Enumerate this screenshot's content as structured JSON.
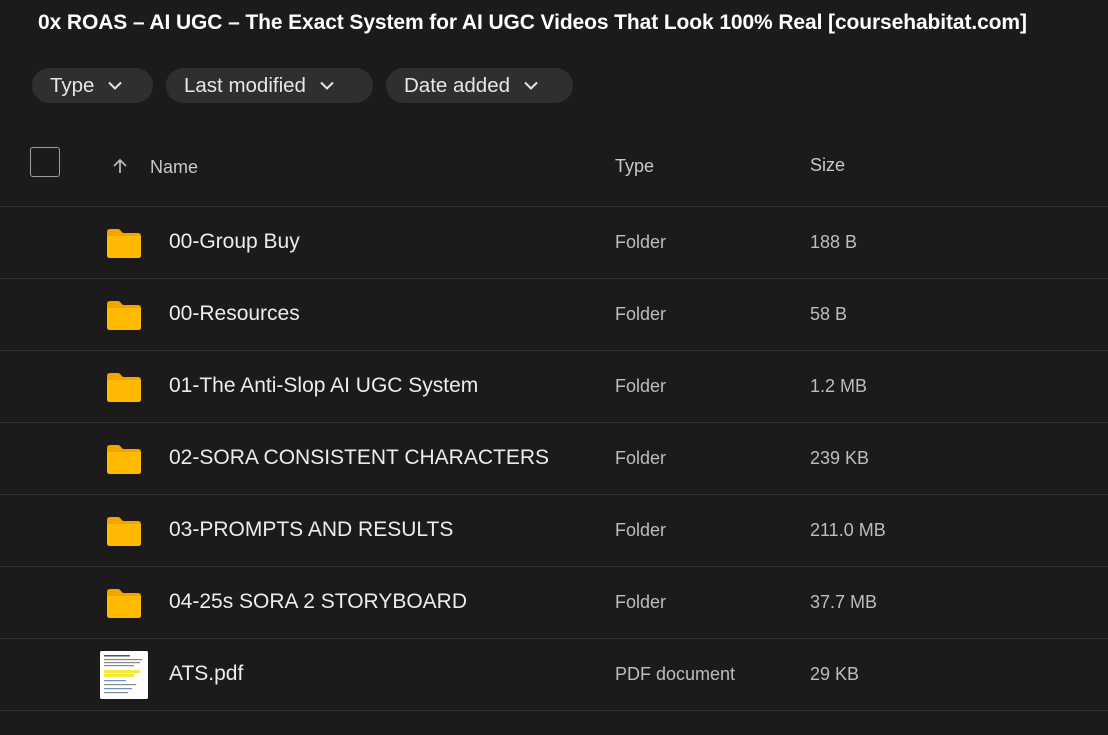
{
  "page": {
    "title": "0x ROAS – AI UGC – The Exact System for AI UGC Videos That Look 100% Real [coursehabitat.com]"
  },
  "filters": [
    {
      "label": "Type"
    },
    {
      "label": "Last modified"
    },
    {
      "label": "Date added"
    }
  ],
  "columns": {
    "name": "Name",
    "type": "Type",
    "size": "Size",
    "sort_direction": "ascending"
  },
  "files": [
    {
      "name": "00-Group Buy",
      "type": "Folder",
      "size": "188 B",
      "icon": "folder-icon"
    },
    {
      "name": "00-Resources",
      "type": "Folder",
      "size": "58 B",
      "icon": "folder-icon"
    },
    {
      "name": "01-The Anti-Slop AI UGC System",
      "type": "Folder",
      "size": "1.2 MB",
      "icon": "folder-icon"
    },
    {
      "name": "02-SORA CONSISTENT CHARACTERS",
      "type": "Folder",
      "size": "239 KB",
      "icon": "folder-icon"
    },
    {
      "name": "03-PROMPTS AND RESULTS",
      "type": "Folder",
      "size": "211.0 MB",
      "icon": "folder-icon"
    },
    {
      "name": "04-25s SORA 2 STORYBOARD",
      "type": "Folder",
      "size": "37.7 MB",
      "icon": "folder-icon"
    },
    {
      "name": "ATS.pdf",
      "type": "PDF document",
      "size": "29 KB",
      "icon": "pdf-thumbnail"
    }
  ],
  "colors": {
    "background": "#1b1b1b",
    "chip": "#2e2f31",
    "folder": "#ffb300",
    "divider": "#333436"
  }
}
